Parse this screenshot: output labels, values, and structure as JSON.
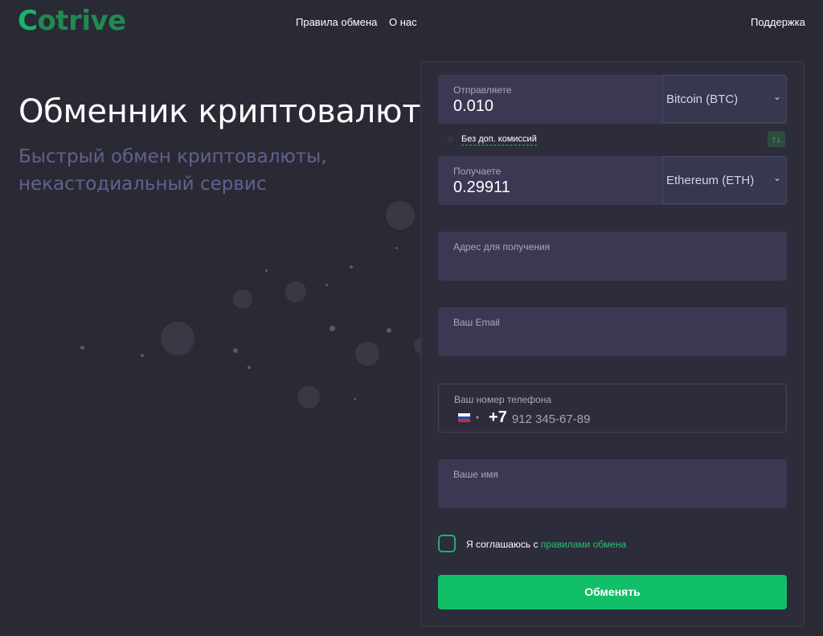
{
  "header": {
    "logo_first": "C",
    "logo_rest": "otrive",
    "nav": [
      "Правила обмена",
      "О нас"
    ],
    "support": "Поддержка"
  },
  "hero": {
    "title": "Обменник криптовалют",
    "subtitle": "Быстрый обмен криптовалюты, некастодиальный сервис"
  },
  "exchange": {
    "send": {
      "label": "Отправляете",
      "value": "0.010",
      "currency": "Bitcoin (BTC)"
    },
    "fee_link": "Без доп. комиссий",
    "swap_icon": "↑↓",
    "receive": {
      "label": "Получаете",
      "value": "0.29911",
      "currency": "Ethereum (ETH)"
    },
    "address_label": "Адрес для получения",
    "email_label": "Ваш Email",
    "phone": {
      "label": "Ваш номер телефона",
      "code": "+7",
      "placeholder": "912 345-67-89"
    },
    "name_label": "Ваше имя",
    "agree_text": "Я соглашаюсь с ",
    "agree_link": "правилами обмена",
    "submit": "Обменять"
  },
  "colors": {
    "accent": "#12bf69",
    "background": "#2a2a35",
    "panel": "#2d2c3a",
    "field": "#3a3853",
    "subtitle": "#63608f"
  },
  "icons": [
    "chevron-down-icon",
    "swap-icon",
    "flag-russia-icon"
  ]
}
